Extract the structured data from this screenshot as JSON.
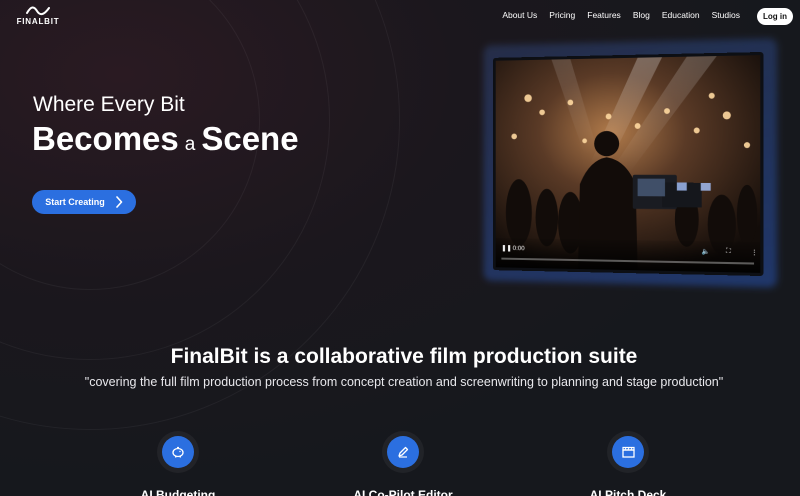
{
  "brand": {
    "logo_text": "FINALBIT"
  },
  "nav": {
    "links": [
      "About Us",
      "Pricing",
      "Features",
      "Blog",
      "Education",
      "Studios"
    ],
    "login_label": "Log in"
  },
  "hero": {
    "line1": "Where Every Bit",
    "line2_part1": "Becomes",
    "line2_part2": "a",
    "line2_part3": "Scene",
    "cta_label": "Start Creating"
  },
  "video": {
    "time": "0:00",
    "progress": 0
  },
  "intro": {
    "title": "FinalBit is a collaborative film production suite",
    "subtitle": "\"covering the full film production process from concept creation and screenwriting to planning and stage production\""
  },
  "features": [
    {
      "label": "AI Budgeting",
      "icon": "piggy-bank-icon"
    },
    {
      "label": "AI Co-Pilot Editor",
      "icon": "pen-edit-icon"
    },
    {
      "label": "AI Pitch Deck",
      "icon": "clapperboard-icon"
    }
  ],
  "colors": {
    "accent": "#2b6fe0",
    "background": "#16181d"
  }
}
